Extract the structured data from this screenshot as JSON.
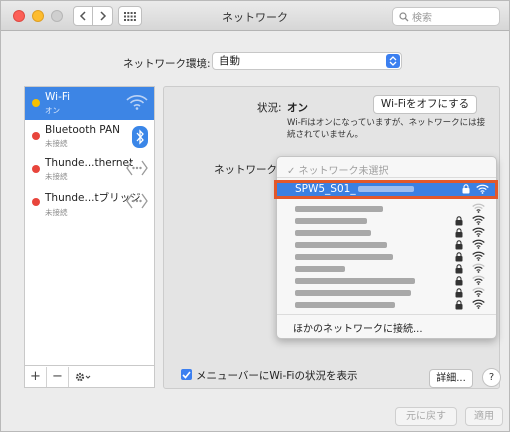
{
  "window": {
    "title": "ネットワーク"
  },
  "toolbar": {
    "search_placeholder": "検索"
  },
  "location": {
    "label": "ネットワーク環境:",
    "value": "自動"
  },
  "sidebar": {
    "items": [
      {
        "name": "Wi-Fi",
        "status": "オン",
        "dot": "yellow",
        "icon": "wifi-icon"
      },
      {
        "name": "Bluetooth PAN",
        "status": "未接続",
        "dot": "red",
        "icon": "bluetooth-icon"
      },
      {
        "name": "Thunde...thernet",
        "status": "未接続",
        "dot": "red",
        "icon": "ethernet-icon"
      },
      {
        "name": "Thunde...tブリッジ",
        "status": "未接続",
        "dot": "red",
        "icon": "bridge-icon"
      }
    ],
    "footer": {
      "add": "+",
      "remove": "−"
    }
  },
  "detail": {
    "status_label": "状況:",
    "status_value": "オン",
    "wifi_off_button": "Wi-Fiをオフにする",
    "status_description": "Wi-Fiはオンになっていますが、ネットワークには接続されていません。",
    "network_name_label": "ネットワーク名"
  },
  "dropdown": {
    "none_selected": "✓ ネットワーク未選択",
    "selected_network": "SPW5_S01_",
    "other_network": "ほかのネットワークに接続...",
    "highlight_color": "#e2582b"
  },
  "footer": {
    "show_in_menubar": "メニューバーにWi-Fiの状況を表示",
    "advanced_button": "詳細...",
    "help_button": "?",
    "revert_button": "元に戻す",
    "apply_button": "適用"
  },
  "colors": {
    "accent": "#3d85e5"
  }
}
